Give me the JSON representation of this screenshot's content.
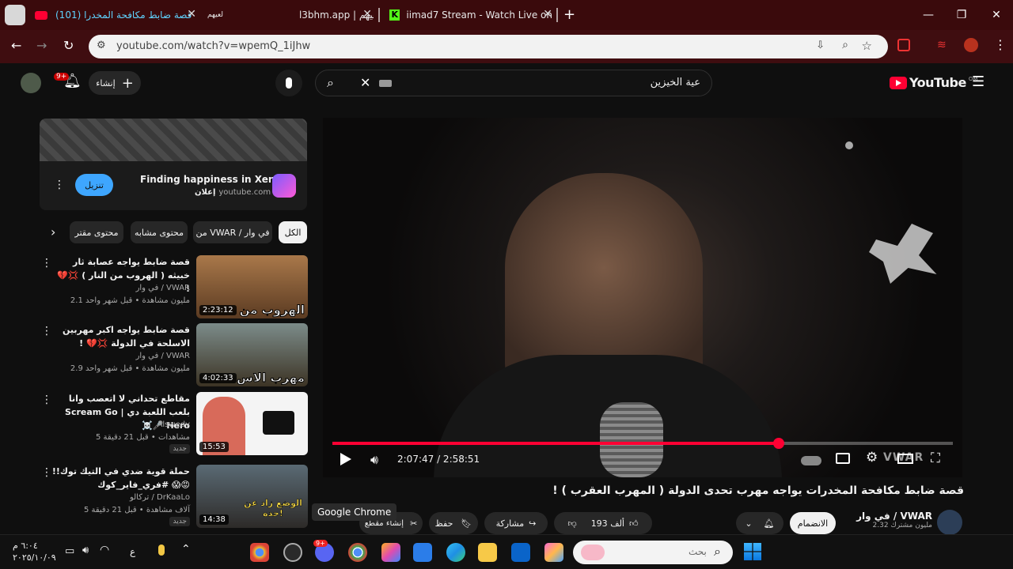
{
  "browser": {
    "tabs": [
      {
        "title": "(101) قصة ضابط مكافحة المخدرا",
        "active": true
      },
      {
        "title": "لعيهم",
        "active": false
      },
      {
        "title": "l3bhm.app | لعيهم",
        "active": false
      },
      {
        "title": "iimad7 Stream - Watch Live on",
        "active": false
      }
    ],
    "new_tab": "+",
    "url": "youtube.com/watch?v=wpemQ_1iJhw"
  },
  "youtube": {
    "logo": "YouTube",
    "country_code": "OM",
    "search_query": "عية الخيزين",
    "create_label": "إنشاء",
    "notif_count": "9+"
  },
  "ad": {
    "title": "Finding happiness in Xena",
    "domain": "youtube.com",
    "sponsored": "إعلان",
    "cta": "تنزيل"
  },
  "chips": [
    "الكل",
    "من VWAR / في وار",
    "محتوى مشابه",
    "محتوى مقتر"
  ],
  "recommendations": [
    {
      "title": "قصة ضابط يواجه عصابة ثار خبيثه ( الهروب من النار ) 💢💔 !",
      "channel": "في وار / VWAR",
      "meta": "2.1 مليون مشاهدة • قبل شهر واحد",
      "duration": "2:23:12",
      "thumb_text": "الهروب من",
      "badge": ""
    },
    {
      "title": "قصة ضابط يواجه اكبر مهربين الاسلحة في الدولة 💢💔 !",
      "channel": "في وار / VWAR",
      "meta": "2.9 مليون مشاهدة • قبل شهر واحد",
      "duration": "4:02:33",
      "thumb_text": "مهرب الاس",
      "badge": ""
    },
    {
      "title": "مقاطع تحداني لا اتعصب وانا بلعب اللعبة دي | Scream Go Hero 🎤☠️",
      "channel": "Alswedy",
      "meta": "5 مشاهدات • قبل 21 دقيقة",
      "duration": "15:53",
      "thumb_text": "",
      "badge": "جديد"
    },
    {
      "title": "حملة قوية ضدي في التيك توك!!😡😱 #فري_فاير_كوك",
      "channel": "تركالو / DrKaaLo",
      "meta": "5 آلاف مشاهدة • قبل 21 دقيقة",
      "duration": "14:38",
      "thumb_text": "الوضع زاد عن حده!",
      "badge": "جديد"
    }
  ],
  "player": {
    "time": "2:07:47 / 2:58:51",
    "progress": 0.72,
    "watermark": "VWAR"
  },
  "video": {
    "title": "قصة ضابط مكافحة المخدرات يواجه مهرب تحدى الدولة ( المهرب العقرب ) !",
    "channel": "في وار / VWAR",
    "subs": "2.32 مليون مشترك",
    "join": "الانضمام",
    "likes": "193 ألف",
    "share": "مشاركة",
    "save": "حفظ",
    "clip": "إنشاء مقطع"
  },
  "tooltip": "Google Chrome",
  "taskbar": {
    "search_placeholder": "بحث",
    "time": "٦:٠٤ م",
    "date": "٢٠٢٥/١٠/٠٩",
    "lang": "ع",
    "discord_badge": "9+"
  },
  "colors": {
    "accent": "#ff0033",
    "chrome_frame": "#3a0a0c",
    "bg": "#0f0f0f"
  }
}
